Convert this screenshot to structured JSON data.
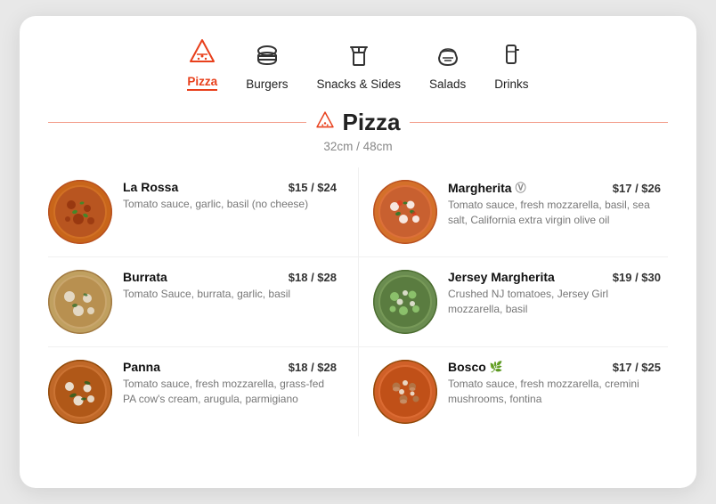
{
  "nav": {
    "items": [
      {
        "id": "pizza",
        "label": "Pizza",
        "active": true
      },
      {
        "id": "burgers",
        "label": "Burgers",
        "active": false
      },
      {
        "id": "snacks",
        "label": "Snacks & Sides",
        "active": false
      },
      {
        "id": "salads",
        "label": "Salads",
        "active": false
      },
      {
        "id": "drinks",
        "label": "Drinks",
        "active": false
      }
    ]
  },
  "section": {
    "title": "Pizza",
    "subtitle": "32cm / 48cm"
  },
  "menu": {
    "items": [
      {
        "id": "la-rossa",
        "name": "La Rossa",
        "badge": "",
        "description": "Tomato sauce, garlic, basil (no cheese)",
        "price": "$15 / $24",
        "col": "left",
        "color": "#c45c2a"
      },
      {
        "id": "margherita",
        "name": "Margherita",
        "badge": "⓪",
        "description": "Tomato sauce, fresh mozzarella, basil, sea salt, California extra virgin olive oil",
        "price": "$17 / $26",
        "col": "right",
        "color": "#e07843"
      },
      {
        "id": "burrata",
        "name": "Burrata",
        "badge": "",
        "description": "Tomato Sauce, burrata, garlic, basil",
        "price": "$18 / $28",
        "col": "left",
        "color": "#b8a070"
      },
      {
        "id": "jersey-margherita",
        "name": "Jersey Margherita",
        "badge": "",
        "description": "Crushed NJ tomatoes, Jersey Girl mozzarella, basil",
        "price": "$19 / $30",
        "col": "right",
        "color": "#6a8c50"
      },
      {
        "id": "panna",
        "name": "Panna",
        "badge": "",
        "description": "Tomato sauce, fresh mozzarella, grass-fed PA cow's cream, arugula, parmigiano",
        "price": "$18 / $28",
        "col": "left",
        "color": "#c0703a"
      },
      {
        "id": "bosco",
        "name": "Bosco",
        "badge": "🌿",
        "description": "Tomato sauce, fresh mozzarella, cremini mushrooms, fontina",
        "price": "$17 / $25",
        "col": "right",
        "color": "#d4602a"
      }
    ]
  }
}
